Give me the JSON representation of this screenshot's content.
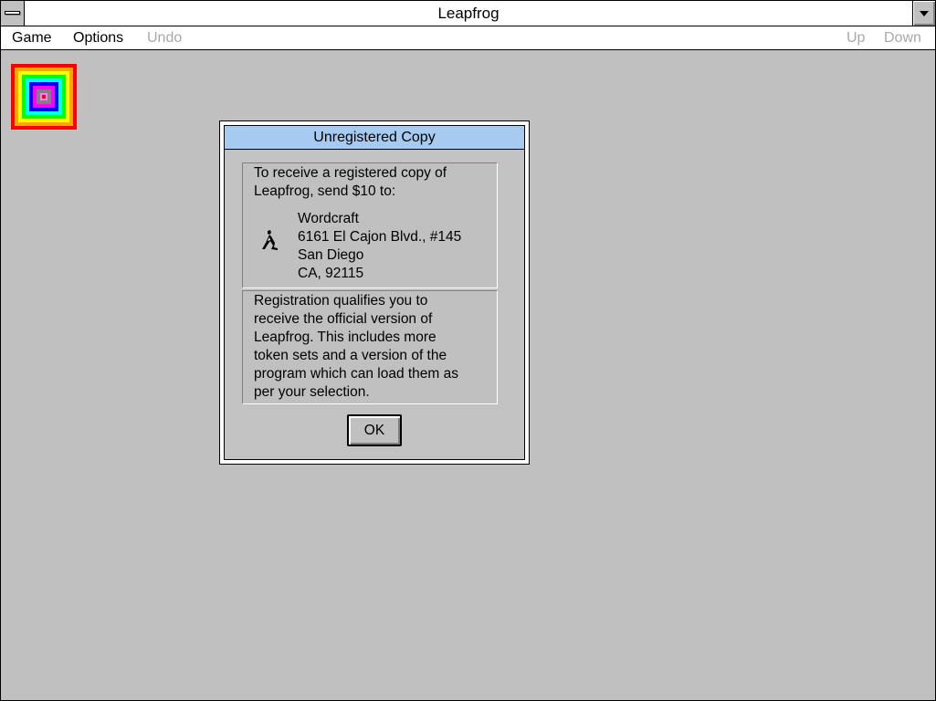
{
  "window": {
    "title": "Leapfrog"
  },
  "menubar": {
    "game": "Game",
    "options": "Options",
    "undo": "Undo",
    "up": "Up",
    "down": "Down"
  },
  "board_icon": {
    "name": "concentric-squares-icon",
    "colors": [
      "#ff0000",
      "#ffa500",
      "#ffff00",
      "#00ff00",
      "#00ffff",
      "#0000ff",
      "#ff00ff",
      "#808080",
      "#ff80ff"
    ]
  },
  "dialog": {
    "title": "Unregistered Copy",
    "intro_lines": [
      "To receive a registered copy of",
      "Leapfrog, send $10 to:"
    ],
    "address_lines": [
      "Wordcraft",
      "6161 El Cajon Blvd., #145",
      "San Diego",
      "CA, 92115"
    ],
    "body_lines": [
      "Registration qualifies you to",
      "receive the official version of",
      "Leapfrog.  This includes more",
      "token sets and a version of the",
      "program which can load them as",
      "per your selection."
    ],
    "ok_label": "OK",
    "accent_color": "#a6caf0"
  }
}
